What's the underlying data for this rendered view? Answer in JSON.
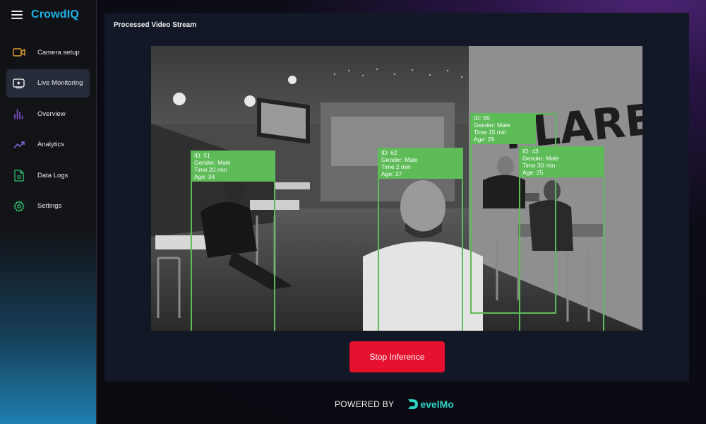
{
  "brand": {
    "name": "CrowdIQ",
    "color": "#20b4ea"
  },
  "sidebar": {
    "items": [
      {
        "label": "Camera setup",
        "icon": "camera-icon",
        "color": "#e5a531",
        "active": false
      },
      {
        "label": "Live Monitoring",
        "icon": "play-icon",
        "color": "#ffffff",
        "active": true
      },
      {
        "label": "Overview",
        "icon": "bar-chart-icon",
        "color": "#8a4fd6",
        "active": false
      },
      {
        "label": "Analytics",
        "icon": "trend-icon",
        "color": "#7a6ce0",
        "active": false
      },
      {
        "label": "Data Logs",
        "icon": "document-icon",
        "color": "#2fbf6a",
        "active": false
      },
      {
        "label": "Settings",
        "icon": "gear-icon",
        "color": "#2fbf6a",
        "active": false
      }
    ]
  },
  "main": {
    "title": "Processed Video Stream",
    "detection_color": "#5dbb58",
    "detections": [
      {
        "id": "ID: 51",
        "gender": "Gender: Male",
        "time": "Time 20 min",
        "age": "Age: 34"
      },
      {
        "id": "ID: 62",
        "gender": "Gender: Male",
        "time": "Time 2 min",
        "age": "Age: 37"
      },
      {
        "id": "ID: 55",
        "gender": "Gender: Male",
        "time": "Time 15 min",
        "age": "Age: 29"
      },
      {
        "id": "ID: 43",
        "gender": "Gender: Male",
        "time": "Time 30 min",
        "age": "Age: 25"
      }
    ],
    "stop_button": "Stop Inference",
    "stop_color": "#e5112e"
  },
  "footer": {
    "powered": "POWERED BY",
    "logo_text": "evelMo",
    "logo_color": "#2fd4c6"
  }
}
